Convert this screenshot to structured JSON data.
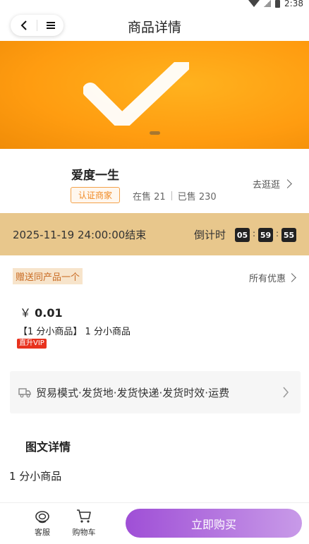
{
  "status": {
    "time": "2:38"
  },
  "header": {
    "title": "商品详情",
    "back_icon": "back-arrow-icon",
    "menu_icon": "menu-icon"
  },
  "banner": {
    "image_icon": "check-icon"
  },
  "shop": {
    "name": "爱度一生",
    "cert_badge": "认证商家",
    "on_sale": "在售 21",
    "sold": "已售 230",
    "go_shop": "去逛逛"
  },
  "countdown": {
    "end_text": "2025-11-19 24:00:00结束",
    "label": "倒计时",
    "hours": "05",
    "minutes": "59",
    "seconds": "55",
    "colon": ":"
  },
  "promo": {
    "gift": "赠送同产品一个",
    "all_offers": "所有优惠",
    "currency": "￥",
    "price": "0.01",
    "product_name": "【1 分小商品】 1 分小商品",
    "vip_badge": "直升VIP"
  },
  "trade": {
    "text": "贸易模式·发货地·发货快递·发货时效·运费"
  },
  "detail": {
    "title": "图文详情",
    "content": "1 分小商品"
  },
  "bottom": {
    "service": "客服",
    "cart": "购物车",
    "buy": "立即购买"
  },
  "colors": {
    "accent": "#ff9c10",
    "buy_gradient_start": "#9f4fd6",
    "countdown_bg": "#e8c78c",
    "vip": "#e8321e"
  }
}
